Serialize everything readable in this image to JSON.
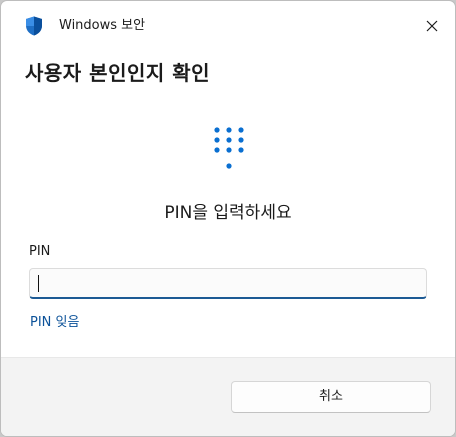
{
  "window": {
    "title": "Windows 보안",
    "app_icon": "shield-icon",
    "close_icon": "close-icon"
  },
  "dialog": {
    "heading": "사용자 본인인지 확인",
    "keypad_icon": "keypad-icon",
    "prompt": "PIN을 입력하세요",
    "pin_label": "PIN",
    "pin_value": "",
    "forgot_link": "PIN 잊음"
  },
  "footer": {
    "cancel_label": "취소"
  },
  "colors": {
    "accent": "#0078d4",
    "link": "#0c5299",
    "input_underline": "#1c5a94",
    "footer_bg": "#f3f3f3"
  }
}
